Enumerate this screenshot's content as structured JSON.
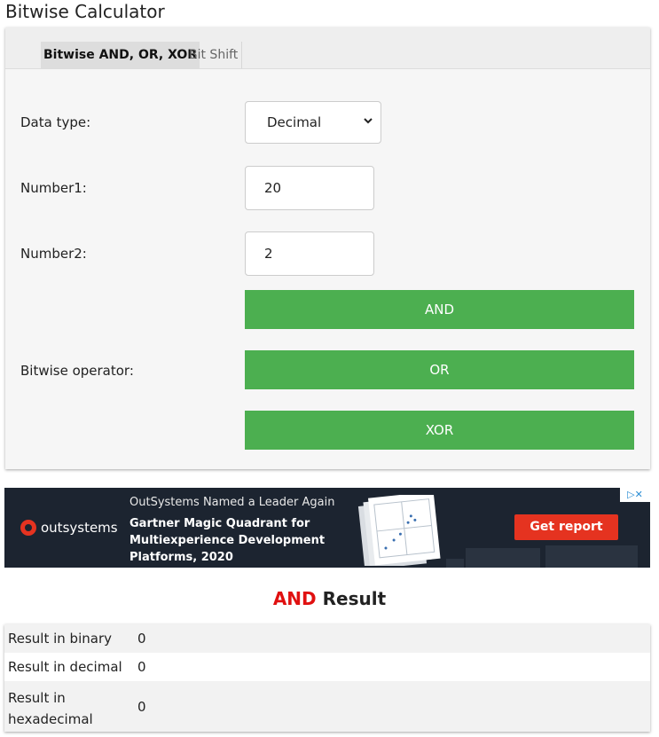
{
  "page": {
    "title": "Bitwise Calculator"
  },
  "tabs": [
    {
      "label": "Bitwise AND, OR, XOR"
    },
    {
      "label": "Bit Shift"
    }
  ],
  "form": {
    "data_type_label": "Data type:",
    "data_type_value": "Decimal",
    "number1_label": "Number1:",
    "number1_value": "20",
    "number2_label": "Number2:",
    "number2_value": "2",
    "operator_label": "Bitwise operator:",
    "buttons": {
      "and": "AND",
      "or": "OR",
      "xor": "XOR"
    }
  },
  "ad": {
    "brand": "outsystems",
    "headline": "OutSystems Named a Leader Again",
    "body_lines": [
      "Gartner Magic Quadrant for",
      "Multiexperience Development",
      "Platforms, 2020"
    ],
    "cta": "Get report",
    "choices_icons": "▷✕"
  },
  "result": {
    "operator": "AND",
    "title_suffix": "Result",
    "rows": [
      {
        "label": "Result in binary",
        "value": "0"
      },
      {
        "label": "Result in decimal",
        "value": "0"
      },
      {
        "label_line1": "Result in",
        "label_line2": "hexadecimal",
        "value": "0"
      }
    ]
  },
  "colors": {
    "button": "#4caf50",
    "accent_red": "#e01010",
    "ad_cta": "#e53320"
  }
}
